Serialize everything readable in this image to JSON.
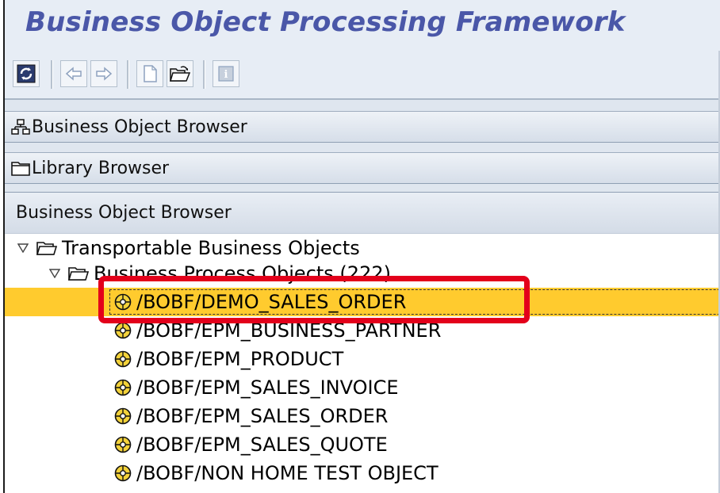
{
  "window": {
    "title": "Business Object Processing Framework"
  },
  "toolbar": {
    "buttons": [
      {
        "icon": "refresh-icon",
        "enabled": true
      },
      {
        "icon": "back-arrow-icon",
        "enabled": false
      },
      {
        "icon": "forward-arrow-icon",
        "enabled": false
      },
      {
        "icon": "new-document-icon",
        "enabled": false
      },
      {
        "icon": "open-folder-icon",
        "enabled": true
      },
      {
        "icon": "info-icon",
        "enabled": false
      }
    ]
  },
  "panels": {
    "bo_browser": {
      "label": "Business Object Browser",
      "icon": "hierarchy-icon"
    },
    "library_browser": {
      "label": "Library Browser",
      "icon": "folder-icon"
    }
  },
  "tree": {
    "header": "Business Object Browser",
    "root": {
      "label": "Transportable Business Objects",
      "expanded": true
    },
    "group": {
      "label": "Business Process Objects (222)",
      "expanded": true
    },
    "items": [
      {
        "label": "/BOBF/DEMO_SALES_ORDER",
        "selected": true
      },
      {
        "label": "/BOBF/EPM_BUSINESS_PARTNER",
        "selected": false
      },
      {
        "label": "/BOBF/EPM_PRODUCT",
        "selected": false
      },
      {
        "label": "/BOBF/EPM_SALES_INVOICE",
        "selected": false
      },
      {
        "label": "/BOBF/EPM_SALES_ORDER",
        "selected": false
      },
      {
        "label": "/BOBF/EPM_SALES_QUOTE",
        "selected": false
      },
      {
        "label": "/BOBF/NON HOME TEST OBJECT",
        "selected": false
      }
    ]
  },
  "colors": {
    "title": "#4a57a8",
    "selection": "#ffcb2e",
    "callout": "#e3001b"
  }
}
